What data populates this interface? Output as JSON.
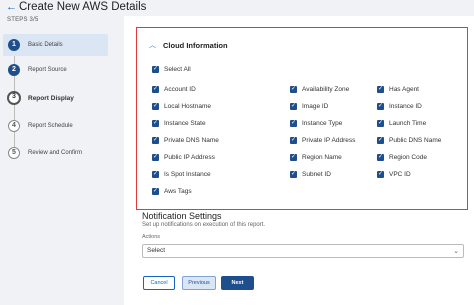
{
  "header": {
    "title": "Create New AWS Details"
  },
  "steps": {
    "label": "STEPS 3/5",
    "items": [
      {
        "number": "1",
        "label": "Basic Details"
      },
      {
        "number": "2",
        "label": "Report Source"
      },
      {
        "number": "3",
        "label": "Report Display"
      },
      {
        "number": "4",
        "label": "Report Schedule"
      },
      {
        "number": "5",
        "label": "Review and Confirm"
      }
    ]
  },
  "cloud": {
    "title": "Cloud Information",
    "select_all": "Select All",
    "columns": [
      [
        "Account ID",
        "Local Hostname",
        "Instance State",
        "Private DNS Name",
        "Public IP Address",
        "Is Spot Instance",
        "Aws Tags"
      ],
      [
        "Availability Zone",
        "Image ID",
        "Instance Type",
        "Private IP Address",
        "Region Name",
        "Subnet ID"
      ],
      [
        "Has Agent",
        "Instance ID",
        "Launch Time",
        "Public DNS Name",
        "Region Code",
        "VPC ID"
      ]
    ]
  },
  "notification": {
    "title": "Notification Settings",
    "subtitle": "Set up notifications on execution of this report.",
    "actions_label": "Actions",
    "actions_value": "Select"
  },
  "buttons": {
    "cancel": "Cancel",
    "previous": "Previous",
    "next": "Next"
  },
  "colors": {
    "accent": "#1f4e8c",
    "highlight_border": "#e53935",
    "active_step_bg": "#dbe6f4"
  }
}
